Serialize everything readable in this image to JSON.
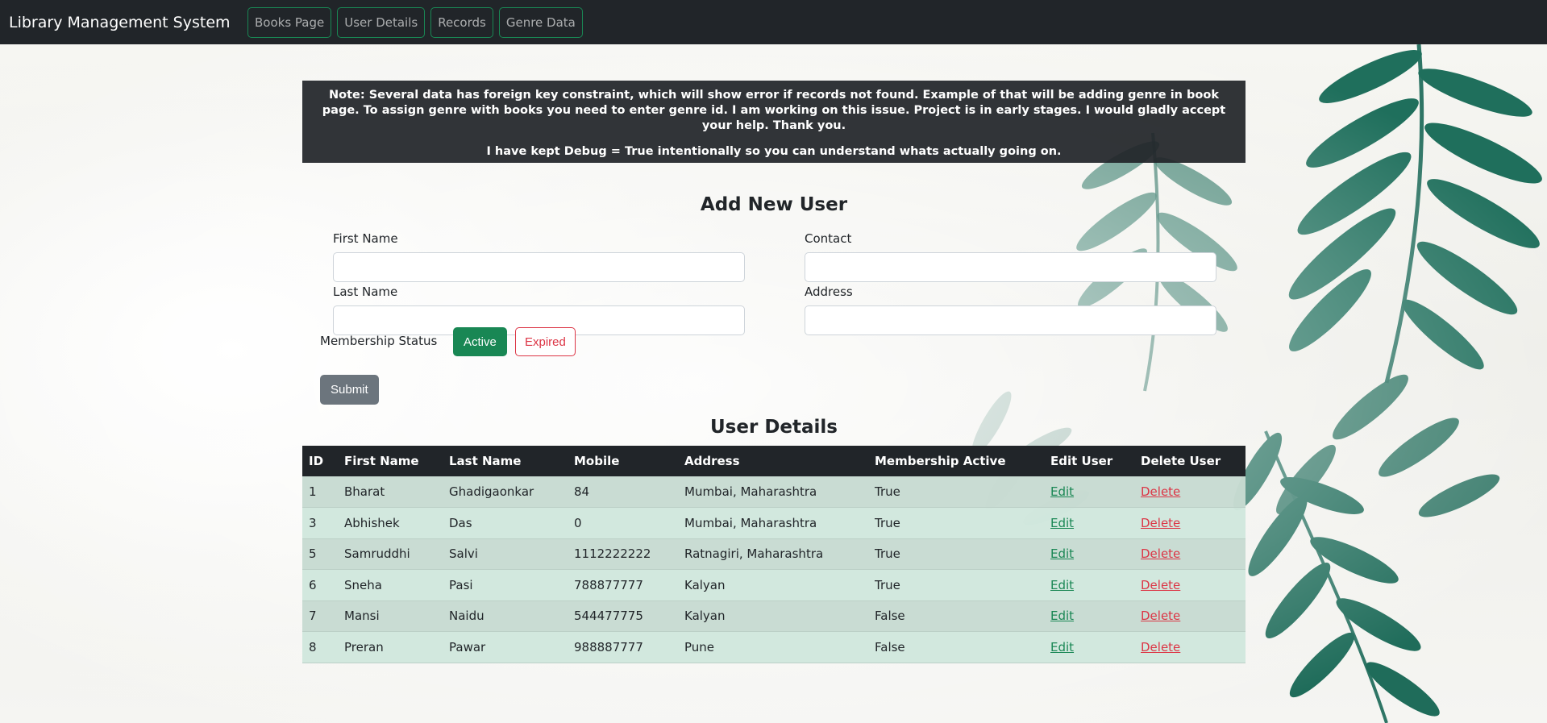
{
  "app": {
    "title": "Library Management System"
  },
  "nav": {
    "items": [
      {
        "label": "Books Page"
      },
      {
        "label": "User Details"
      },
      {
        "label": "Records"
      },
      {
        "label": "Genre Data"
      }
    ]
  },
  "note": {
    "line1": "Note: Several data has foreign key constraint, which will show error if records not found. Example of that will be adding genre in book page. To assign genre with books you need to enter genre id. I am working on this issue. Project is in early stages. I would gladly accept your help. Thank you.",
    "line2": "I have kept Debug = True intentionally so you can understand whats actually going on."
  },
  "form": {
    "title": "Add New User",
    "first_name": {
      "label": "First Name",
      "value": ""
    },
    "contact": {
      "label": "Contact",
      "value": ""
    },
    "last_name": {
      "label": "Last Name",
      "value": ""
    },
    "address": {
      "label": "Address",
      "value": ""
    },
    "membership_label": "Membership Status",
    "active_label": "Active",
    "expired_label": "Expired",
    "submit_label": "Submit"
  },
  "table": {
    "title": "User Details",
    "headers": [
      "ID",
      "First Name",
      "Last Name",
      "Mobile",
      "Address",
      "Membership Active",
      "Edit User",
      "Delete User"
    ],
    "rows": [
      {
        "id": "1",
        "first": "Bharat",
        "last": "Ghadigaonkar",
        "mobile": "84",
        "address": "Mumbai, Maharashtra",
        "active": "True",
        "edit": "Edit",
        "delete": "Delete"
      },
      {
        "id": "3",
        "first": "Abhishek",
        "last": "Das",
        "mobile": "0",
        "address": "Mumbai, Maharashtra",
        "active": "True",
        "edit": "Edit",
        "delete": "Delete"
      },
      {
        "id": "5",
        "first": "Samruddhi",
        "last": "Salvi",
        "mobile": "1112222222",
        "address": "Ratnagiri, Maharashtra",
        "active": "True",
        "edit": "Edit",
        "delete": "Delete"
      },
      {
        "id": "6",
        "first": "Sneha",
        "last": "Pasi",
        "mobile": "788877777",
        "address": "Kalyan",
        "active": "True",
        "edit": "Edit",
        "delete": "Delete"
      },
      {
        "id": "7",
        "first": "Mansi",
        "last": "Naidu",
        "mobile": "544477775",
        "address": "Kalyan",
        "active": "False",
        "edit": "Edit",
        "delete": "Delete"
      },
      {
        "id": "8",
        "first": "Preran",
        "last": "Pawar",
        "mobile": "988887777",
        "address": "Pune",
        "active": "False",
        "edit": "Edit",
        "delete": "Delete"
      }
    ]
  },
  "colors": {
    "navbar": "#212529",
    "success": "#198754",
    "danger": "#dc3545",
    "secondary": "#6c757d",
    "fern": "#1f6f5c"
  }
}
